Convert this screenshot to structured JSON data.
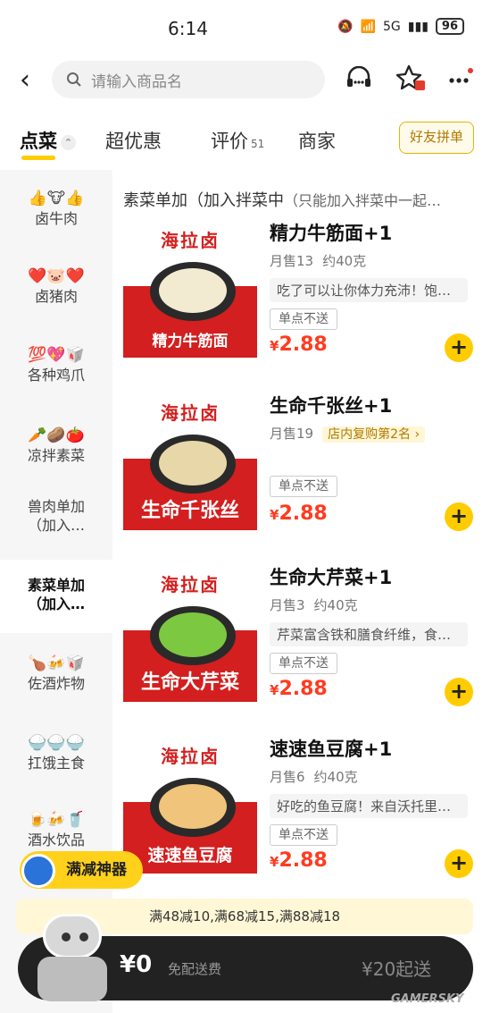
{
  "status": {
    "time": "6:14",
    "network": "5G",
    "battery": "96"
  },
  "search": {
    "placeholder": "请输入商品名"
  },
  "tabs": [
    {
      "label": "点菜"
    },
    {
      "label": "超优惠"
    },
    {
      "label": "评价",
      "count": "51"
    },
    {
      "label": "商家"
    }
  ],
  "friend_order": "好友拼单",
  "sidebar": [
    {
      "emoji": "👍🐮👍",
      "label": "卤牛肉"
    },
    {
      "emoji": "❤️🐷❤️",
      "label": "卤猪肉"
    },
    {
      "emoji": "💯💖🥡",
      "label": "各种鸡爪"
    },
    {
      "emoji": "🥕🥔🍅",
      "label": "凉拌素菜"
    },
    {
      "emoji": "",
      "label": "兽肉单加（加入…"
    },
    {
      "emoji": "",
      "label": "素菜单加（加入…"
    },
    {
      "emoji": "🍗🍻🥡",
      "label": "佐酒炸物"
    },
    {
      "emoji": "🍚🍚🍚",
      "label": "扛饿主食"
    },
    {
      "emoji": "🍺🍻🥤",
      "label": "酒水饮品"
    }
  ],
  "section": {
    "title": "素菜单加（加入拌菜中",
    "note": "（只能加入拌菜中一起…"
  },
  "items": [
    {
      "brand": "海拉卤",
      "caption": "精力牛筋面",
      "name": "精力牛筋面+1",
      "sales": "月售13",
      "weight": "约40克",
      "rank": "",
      "desc": "吃了可以让你体力充沛！饱…",
      "tag": "单点不送",
      "price": "2.88",
      "food_color": "#f3ead2"
    },
    {
      "brand": "海拉卤",
      "caption": "生命千张丝",
      "name": "生命千张丝+1",
      "sales": "月售19",
      "weight": "",
      "rank": "店内复购第2名 ›",
      "desc": "",
      "tag": "单点不送",
      "price": "2.88",
      "food_color": "#e8d7a8"
    },
    {
      "brand": "海拉卤",
      "caption": "生命大芹菜",
      "name": "生命大芹菜+1",
      "sales": "月售3",
      "weight": "约40克",
      "rank": "",
      "desc": "芹菜富含铁和膳食纤维，食…",
      "tag": "单点不送",
      "price": "2.88",
      "food_color": "#7cc840"
    },
    {
      "brand": "海拉卤",
      "caption": "速速鱼豆腐",
      "name": "速速鱼豆腐+1",
      "sales": "月售6",
      "weight": "约40克",
      "rank": "",
      "desc": "好吃的鱼豆腐！来自沃托里…",
      "tag": "单点不送",
      "price": "2.88",
      "food_color": "#f0c47a"
    }
  ],
  "promo": {
    "manjian_label": "满减神器",
    "text": "满48减10,满68减15,满88减18"
  },
  "cart": {
    "price": "¥0",
    "delivery": "免配送费",
    "minimum": "¥20起送"
  },
  "watermark": "GAMERSKY"
}
